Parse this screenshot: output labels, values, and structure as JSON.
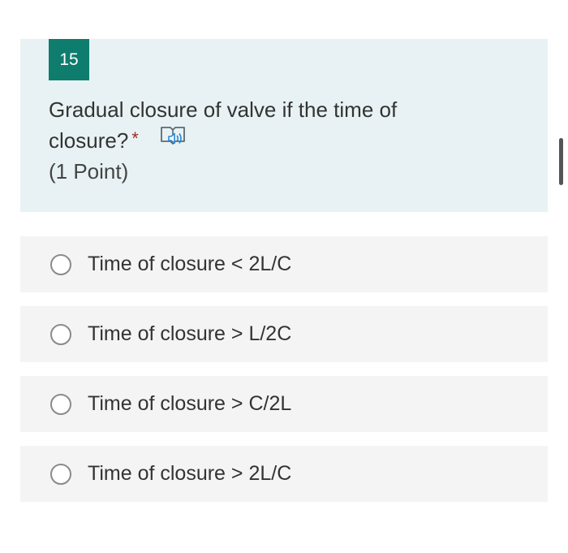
{
  "question": {
    "number": "15",
    "title_line1": "Gradual closure of valve if the time of",
    "title_line2": "closure?",
    "required_marker": "*",
    "points": "(1 Point)",
    "reader_icon": "immersive-reader-icon"
  },
  "options": [
    {
      "label": "Time of closure < 2L/C"
    },
    {
      "label": "Time of closure > L/2C"
    },
    {
      "label": "Time of closure > C/2L"
    },
    {
      "label": "Time of closure > 2L/C"
    }
  ],
  "colors": {
    "accent": "#0f7d6e",
    "card_background": "#e8f2f4",
    "option_background": "#f4f4f4",
    "required": "#a4262c"
  }
}
